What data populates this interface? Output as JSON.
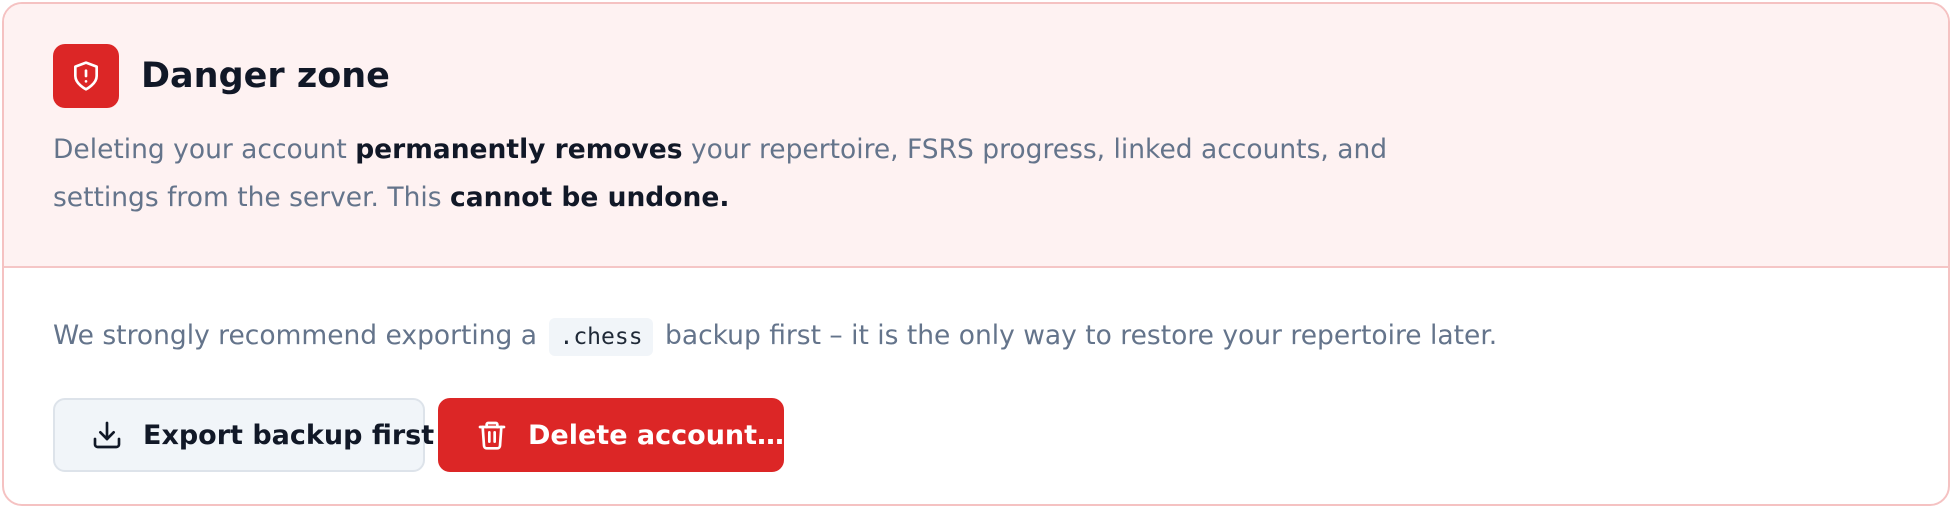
{
  "danger_zone": {
    "title": "Danger zone",
    "icon": "shield-alert-icon",
    "accent_color": "#dc2626",
    "description": {
      "part1": "Deleting your account ",
      "bold1": "permanently removes",
      "part2": " your repertoire, FSRS progress, linked accounts, and settings from the server. This ",
      "bold2": "cannot be undone."
    },
    "recommendation": {
      "before": "We strongly recommend exporting a",
      "code": ".chess",
      "after": "backup first – it is the only way to restore your repertoire later."
    },
    "buttons": {
      "export_label": "Export backup first",
      "export_icon": "download-icon",
      "delete_label": "Delete account…",
      "delete_icon": "trash-icon"
    }
  }
}
